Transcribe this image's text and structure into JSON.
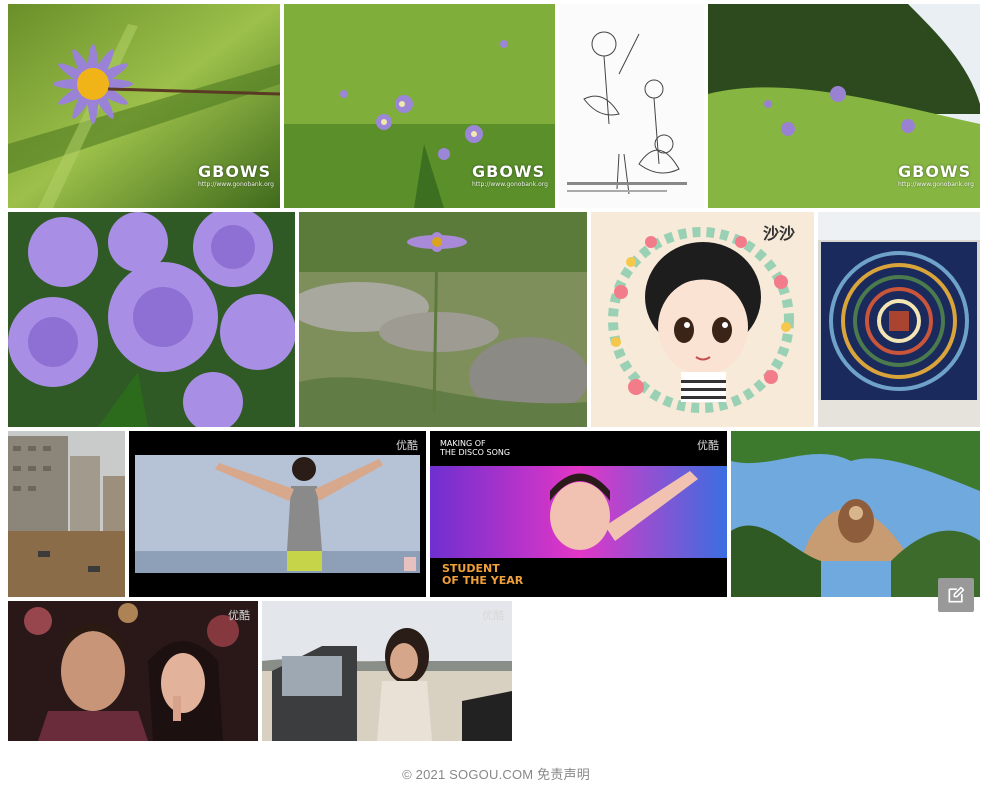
{
  "tiles": [
    {
      "name": "aster-macro-close",
      "watermark": "GBOWS",
      "watermark_url": "http://www.gonobank.org"
    },
    {
      "name": "aster-meadow-field",
      "watermark": "GBOWS",
      "watermark_url": "http://www.gonobank.org"
    },
    {
      "name": "botanical-illustration"
    },
    {
      "name": "aster-hillside",
      "watermark": "GBOWS",
      "watermark_url": "http://www.gonobank.org"
    },
    {
      "name": "purple-aster-cluster"
    },
    {
      "name": "aster-rocky-ground"
    },
    {
      "name": "cartoon-girl-wreath",
      "caption": "沙沙"
    },
    {
      "name": "mandala-tile-panel"
    },
    {
      "name": "flooded-street"
    },
    {
      "name": "dancer-video-still",
      "badge": "优酷"
    },
    {
      "name": "student-of-the-year-still",
      "badge": "优酷",
      "top_text_1": "MAKING OF",
      "top_text_2": "THE DISCO SONG",
      "title_1": "STUDENT",
      "title_2": "OF THE YEAR"
    },
    {
      "name": "buddha-cliff-shrine"
    },
    {
      "name": "couple-video-still",
      "badge": "优酷"
    },
    {
      "name": "car-girl-video-still",
      "badge": "优酷"
    }
  ],
  "feedback": {
    "icon": "edit-icon"
  },
  "footer": {
    "text": "© 2021 SOGOU.COM 免责声明"
  }
}
